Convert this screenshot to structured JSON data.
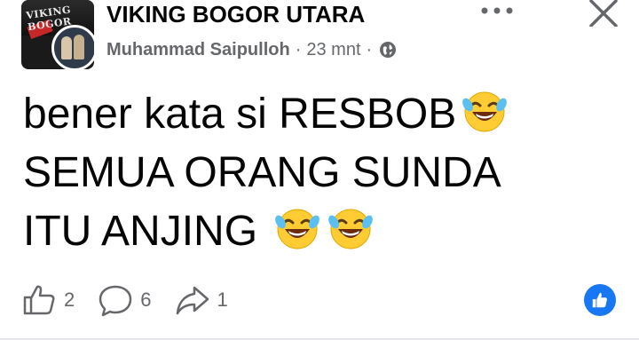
{
  "post": {
    "group_name": "VIKING BOGOR UTARA",
    "author": "Muhammad Saipulloh",
    "separator": "·",
    "time": "23 mnt",
    "avatar_text": "VIKING BOGOR",
    "privacy_icon": "globe-icon",
    "more_icon": "more-icon",
    "close_icon": "close-icon",
    "text_lines": [
      "bener kata si RESBOB",
      "SEMUA ORANG SUNDA",
      "ITU ANJING"
    ],
    "emoji": "face-with-tears-of-joy"
  },
  "actions": {
    "like_count": "2",
    "comment_count": "6",
    "share_count": "1"
  },
  "colors": {
    "accent": "#1877f2",
    "secondary_text": "#65676b",
    "primary_text": "#050505",
    "emoji_yellow": "#ffcc33"
  }
}
